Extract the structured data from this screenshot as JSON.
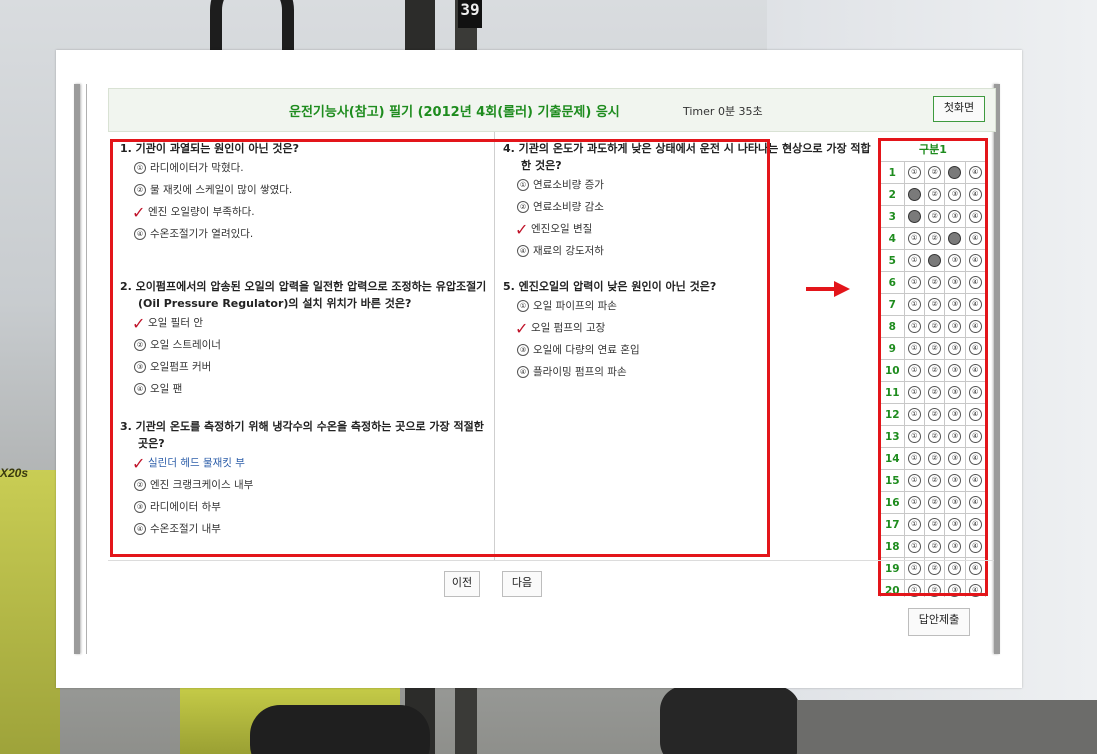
{
  "background": {
    "plate_number": "39",
    "side_text": "X20s"
  },
  "header": {
    "title": "운전기능사(참고) 필기 (2012년 4회(롤러) 기출문제) 응시",
    "timer": "Timer 0분 35초",
    "home_button": "첫화면"
  },
  "questions": [
    {
      "title": "1. 기관이 과열되는 원인이 아닌 것은?",
      "options": [
        {
          "num": "①",
          "text": "라디에이터가 막혔다.",
          "checked": false
        },
        {
          "num": "②",
          "text": "물 재킷에 스케일이 많이 쌓였다.",
          "checked": false
        },
        {
          "num": "③",
          "text": "엔진 오일량이 부족하다.",
          "checked": true
        },
        {
          "num": "④",
          "text": "수온조절기가 열려있다.",
          "checked": false
        }
      ]
    },
    {
      "title": "2. 오이펌프에서의 압송된 오일의 압력을 일전한 압력으로 조정하는 유압조절기(Oil Pressure Regulator)의 설치 위치가 바른 것은?",
      "options": [
        {
          "num": "①",
          "text": "오일 필터 안",
          "checked": true
        },
        {
          "num": "②",
          "text": "오일 스트레이너",
          "checked": false
        },
        {
          "num": "③",
          "text": "오일펌프 커버",
          "checked": false
        },
        {
          "num": "④",
          "text": "오일 팬",
          "checked": false
        }
      ]
    },
    {
      "title": "3. 기관의 온도를 측정하기 위해 냉각수의 수온을 측정하는 곳으로 가장 적절한 곳은?",
      "options": [
        {
          "num": "①",
          "text": "실린더 헤드 물재킷 부",
          "checked": true
        },
        {
          "num": "②",
          "text": "엔진 크랭크케이스 내부",
          "checked": false
        },
        {
          "num": "③",
          "text": "라디에이터 하부",
          "checked": false
        },
        {
          "num": "④",
          "text": "수온조절기 내부",
          "checked": false
        }
      ]
    },
    {
      "title": "4. 기관의 온도가 과도하게 낮은 상태에서 운전 시 나타나는 현상으로 가장 적합한 것은?",
      "options": [
        {
          "num": "①",
          "text": "연료소비량 증가",
          "checked": false
        },
        {
          "num": "②",
          "text": "연료소비량 감소",
          "checked": false
        },
        {
          "num": "③",
          "text": "엔진오일 변질",
          "checked": true
        },
        {
          "num": "④",
          "text": "재료의 강도저하",
          "checked": false
        }
      ]
    },
    {
      "title": "5. 엔진오일의 압력이 낮은 원인이 아닌 것은?",
      "options": [
        {
          "num": "①",
          "text": "오일 파이프의 파손",
          "checked": false
        },
        {
          "num": "②",
          "text": "오일 펌프의 고장",
          "checked": true
        },
        {
          "num": "③",
          "text": "오일에 다량의 연료 혼입",
          "checked": false
        },
        {
          "num": "④",
          "text": "플라이밍 펌프의 파손",
          "checked": false
        }
      ]
    }
  ],
  "answer_grid": {
    "header": "구분1",
    "bubbles": [
      "①",
      "②",
      "③",
      "④"
    ],
    "rows": [
      {
        "n": "1",
        "sel": 3
      },
      {
        "n": "2",
        "sel": 1
      },
      {
        "n": "3",
        "sel": 1
      },
      {
        "n": "4",
        "sel": 3
      },
      {
        "n": "5",
        "sel": 2
      },
      {
        "n": "6",
        "sel": 0
      },
      {
        "n": "7",
        "sel": 0
      },
      {
        "n": "8",
        "sel": 0
      },
      {
        "n": "9",
        "sel": 0
      },
      {
        "n": "10",
        "sel": 0
      },
      {
        "n": "11",
        "sel": 0
      },
      {
        "n": "12",
        "sel": 0
      },
      {
        "n": "13",
        "sel": 0
      },
      {
        "n": "14",
        "sel": 0
      },
      {
        "n": "15",
        "sel": 0
      },
      {
        "n": "16",
        "sel": 0
      },
      {
        "n": "17",
        "sel": 0
      },
      {
        "n": "18",
        "sel": 0
      },
      {
        "n": "19",
        "sel": 0
      },
      {
        "n": "20",
        "sel": 0
      }
    ]
  },
  "nav": {
    "prev": "이전",
    "next": "다음",
    "submit": "답안제출"
  },
  "colors": {
    "accent_green": "#1e8c1e",
    "highlight_red": "#e3151a",
    "check_red": "#c0142a"
  }
}
